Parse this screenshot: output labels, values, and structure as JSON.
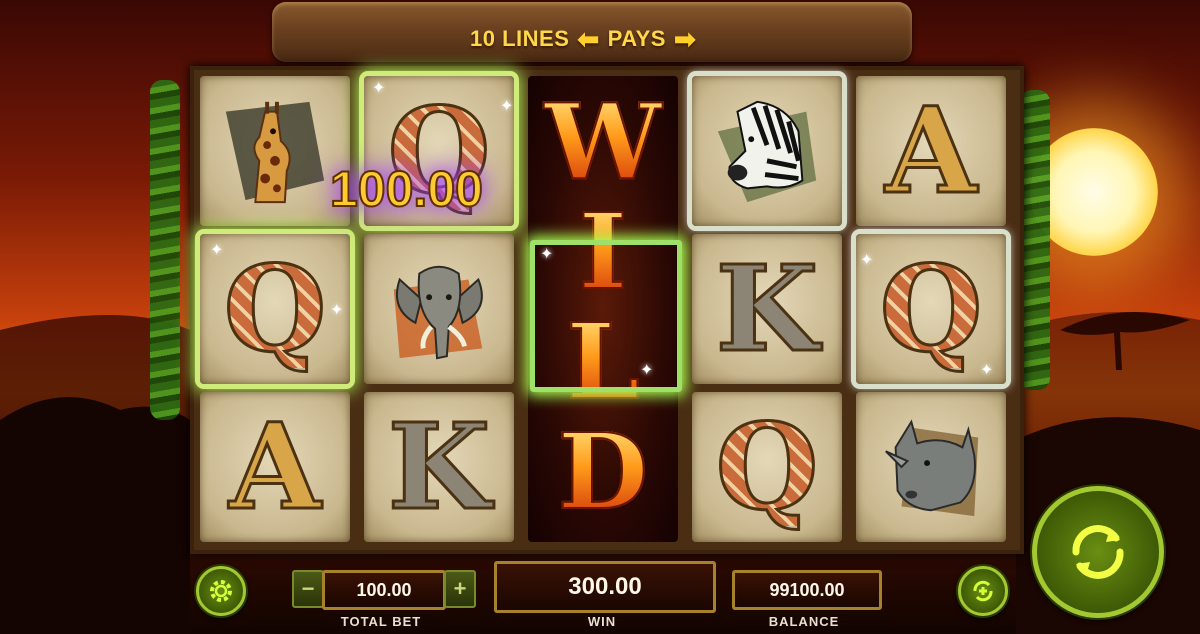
{
  "game": {
    "lines_label": "10 LINES",
    "pays_label": "PAYS",
    "win_popup": "100.00"
  },
  "reels": [
    {
      "symbols": [
        "giraffe",
        "Q",
        "A"
      ]
    },
    {
      "symbols": [
        "Q",
        "elephant",
        "K"
      ]
    },
    {
      "symbols": [
        "WILD"
      ],
      "wild_letters": [
        "W",
        "I",
        "L",
        "D"
      ]
    },
    {
      "symbols": [
        "zebra",
        "K",
        "Q"
      ]
    },
    {
      "symbols": [
        "A",
        "Q",
        "rhino"
      ]
    }
  ],
  "winning_positions": [
    "reel1-row2",
    "reel2-row1",
    "reel3-row2",
    "reel5-row2"
  ],
  "controls": {
    "total_bet": {
      "value": "100.00",
      "label": "TOTAL BET",
      "minus": "−",
      "plus": "+"
    },
    "win": {
      "value": "300.00",
      "label": "WIN"
    },
    "balance": {
      "value": "99100.00",
      "label": "BALANCE"
    }
  },
  "icons": {
    "settings": "gear-icon",
    "autoplay": "autoplay-icon",
    "spin": "spin-arrow-icon"
  },
  "colors": {
    "accent_gold": "#ffd84a",
    "win_glow": "#b6ff5a",
    "button_green": "#6a8e12"
  }
}
